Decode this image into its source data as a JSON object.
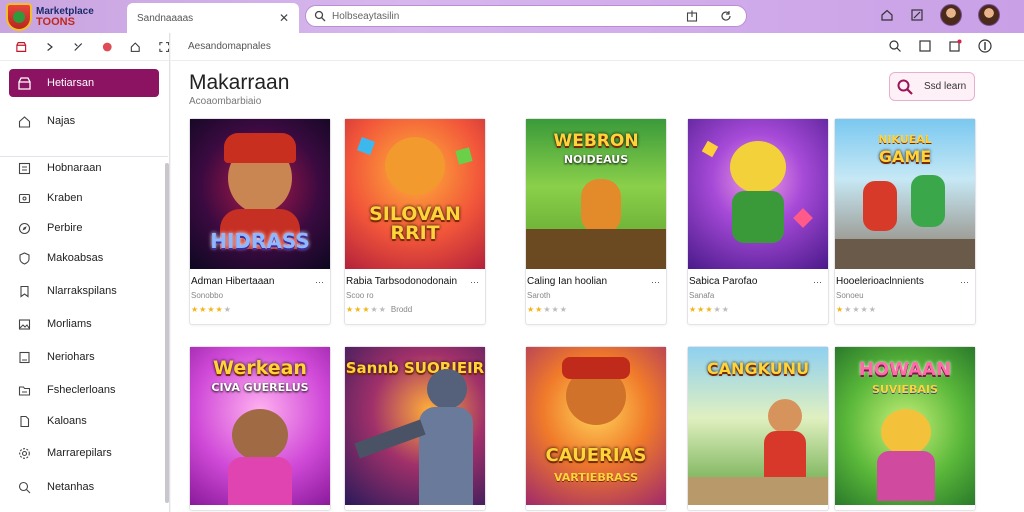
{
  "app": {
    "logo_line1": "Marketplace",
    "logo_line2": "TOONS",
    "tab_title": "Sandnaaaas",
    "url": "Holbseaytasilin"
  },
  "sidebar": {
    "items": [
      {
        "label": "Hetiarsan",
        "icon": "store-icon",
        "active": true
      },
      {
        "label": "Najas",
        "icon": "home-icon"
      },
      {
        "label": "Hobnaraan",
        "icon": "list-icon"
      },
      {
        "label": "Kraben",
        "icon": "tag-icon"
      },
      {
        "label": "Perbire",
        "icon": "compass-icon"
      },
      {
        "label": "Makoabsas",
        "icon": "shield-icon"
      },
      {
        "label": "Nlarrakspilans",
        "icon": "bookmark-icon"
      },
      {
        "label": "Morliams",
        "icon": "image-icon"
      },
      {
        "label": "Neriohars",
        "icon": "note-icon"
      },
      {
        "label": "Fsheclerloans",
        "icon": "folder-icon"
      },
      {
        "label": "Kaloans",
        "icon": "file-icon"
      },
      {
        "label": "Marrarepilars",
        "icon": "gear-icon"
      },
      {
        "label": "Netanhas",
        "icon": "search-icon"
      }
    ]
  },
  "main": {
    "breadcrumb": "Aesandomapnales",
    "title": "Makarraan",
    "subtitle": "Acoaombarbiaio",
    "search_button": "Ssd learn"
  },
  "cards_row1": [
    {
      "name": "Adman Hibertaaan",
      "meta": "Sonobbo",
      "rating": 4,
      "extra": "",
      "art_title": "HIDRASS",
      "art_sub": ""
    },
    {
      "name": "Rabia Tarbsodonodonain",
      "meta": "Scoo ro",
      "rating": 3,
      "extra": "Brodd",
      "art_title": "SILOVAN RRIT",
      "art_sub": ""
    },
    {
      "name": "Caling Ian hoolian",
      "meta": "Saroth",
      "rating": 2,
      "extra": "",
      "art_title": "WEBRON",
      "art_sub": "NOIDEAUS"
    },
    {
      "name": "Sabica Parofao",
      "meta": "Sanafa",
      "rating": 3,
      "extra": "",
      "art_title": "",
      "art_sub": ""
    },
    {
      "name": "Hooelerioaclnnients",
      "meta": "Sonoeu",
      "rating": 1,
      "extra": "",
      "art_title": "GAME",
      "art_sub": "NIKUEAL"
    }
  ],
  "cards_row2": [
    {
      "art_title": "Werkean",
      "art_sub": "CIVA GUERELUS"
    },
    {
      "art_title": "Sannb SUORIEIR",
      "art_sub": ""
    },
    {
      "art_title": "CAUERIAS",
      "art_sub": "VARTIEBRASS"
    },
    {
      "art_title": "CANGKUNU",
      "art_sub": ""
    },
    {
      "art_title": "HOWAAN",
      "art_sub": "SUVIEBAIS"
    }
  ]
}
